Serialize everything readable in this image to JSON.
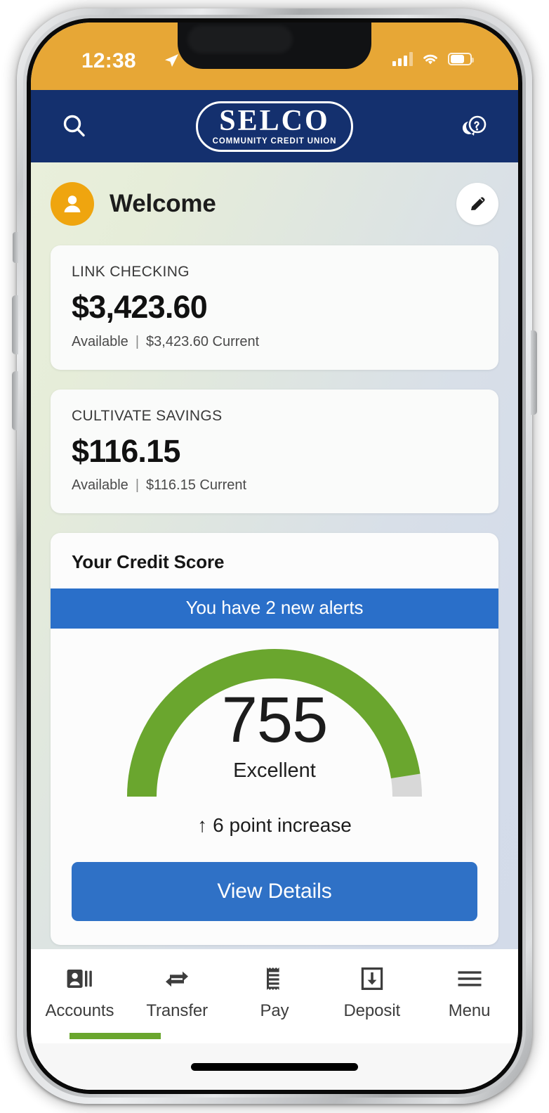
{
  "status_bar": {
    "time": "12:38",
    "location_icon": "location-arrow-icon",
    "signal_icon": "cellular-signal-icon",
    "wifi_icon": "wifi-icon",
    "battery_icon": "battery-icon"
  },
  "header": {
    "search_icon": "search-icon",
    "help_icon": "help-chat-icon",
    "logo_main": "SELCO",
    "logo_sub": "COMMUNITY CREDIT UNION",
    "bg_color": "#14306e"
  },
  "welcome": {
    "avatar_icon": "person-avatar-icon",
    "title": "Welcome",
    "edit_icon": "pencil-edit-icon"
  },
  "accounts": [
    {
      "name": "LINK CHECKING",
      "balance": "$3,423.60",
      "available_label": "Available",
      "divider": "|",
      "current": "$3,423.60 Current"
    },
    {
      "name": "CULTIVATE SAVINGS",
      "balance": "$116.15",
      "available_label": "Available",
      "divider": "|",
      "current": "$116.15 Current"
    }
  ],
  "credit_score": {
    "title": "Your Credit Score",
    "alert_banner": "You have 2 new alerts",
    "score": "755",
    "rating": "Excellent",
    "change_arrow": "↑",
    "change_text": "6 point increase",
    "cta_label": "View Details",
    "gauge_fill_color": "#6aa62e",
    "gauge_track_color": "#d8d8d8",
    "banner_color": "#2a6fc9",
    "cta_color": "#2f71c6",
    "gauge_percent": 95
  },
  "tab_bar": {
    "items": [
      {
        "label": "Accounts",
        "icon": "accounts-card-icon",
        "active": true
      },
      {
        "label": "Transfer",
        "icon": "transfer-arrows-icon",
        "active": false
      },
      {
        "label": "Pay",
        "icon": "receipt-icon",
        "active": false
      },
      {
        "label": "Deposit",
        "icon": "deposit-download-icon",
        "active": false
      },
      {
        "label": "Menu",
        "icon": "hamburger-menu-icon",
        "active": false
      }
    ],
    "active_color": "#6aa62e"
  }
}
